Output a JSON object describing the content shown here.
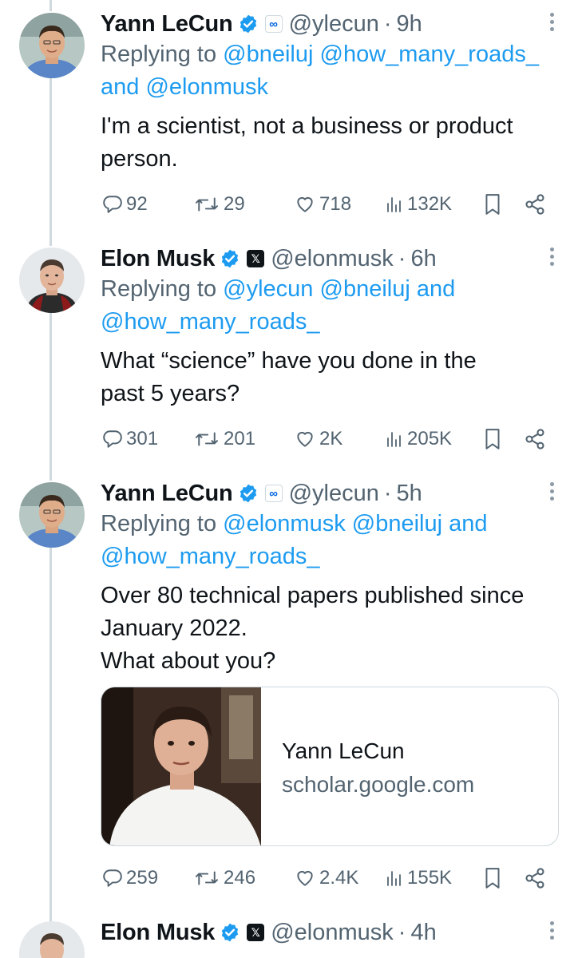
{
  "colors": {
    "accent": "#1d9bf0",
    "muted": "#536471",
    "text": "#0f1419",
    "border": "#cfd9de"
  },
  "tweets": [
    {
      "name": "Yann LeCun",
      "affiliation_icon": "meta-logo-icon",
      "handle": "@ylecun",
      "time": "9h",
      "replying_prefix": "Replying to",
      "mention_1": "@bneiluj",
      "mention_2": "@how_many_roads_",
      "joiner": "and",
      "mention_3": "@elonmusk",
      "text": "I'm a scientist, not a business or product\nperson.",
      "stats": {
        "replies": "92",
        "reposts": "29",
        "likes": "718",
        "views": "132K"
      }
    },
    {
      "name": "Elon Musk",
      "affiliation_icon": "x-logo-icon",
      "handle": "@elonmusk",
      "time": "6h",
      "replying_prefix": "Replying to",
      "mention_1": "@ylecun",
      "mention_2": "@bneiluj",
      "joiner": "and",
      "mention_3": "@how_many_roads_",
      "text": "What “science” have you done in the\npast 5 years?",
      "stats": {
        "replies": "301",
        "reposts": "201",
        "likes": "2K",
        "views": "205K"
      }
    },
    {
      "name": "Yann LeCun",
      "affiliation_icon": "meta-logo-icon",
      "handle": "@ylecun",
      "time": "5h",
      "replying_prefix": "Replying to",
      "mention_1": "@elonmusk",
      "mention_2": "@bneiluj",
      "joiner": "and",
      "mention_3": "@how_many_roads_",
      "text": "Over 80 technical papers published since\nJanuary 2022.\nWhat about you?",
      "card": {
        "title": "Yann LeCun",
        "domain": "scholar.google.com"
      },
      "stats": {
        "replies": "259",
        "reposts": "246",
        "likes": "2.4K",
        "views": "155K"
      }
    },
    {
      "name": "Elon Musk",
      "affiliation_icon": "x-logo-icon",
      "handle": "@elonmusk",
      "time": "4h"
    }
  ],
  "separator": "·"
}
